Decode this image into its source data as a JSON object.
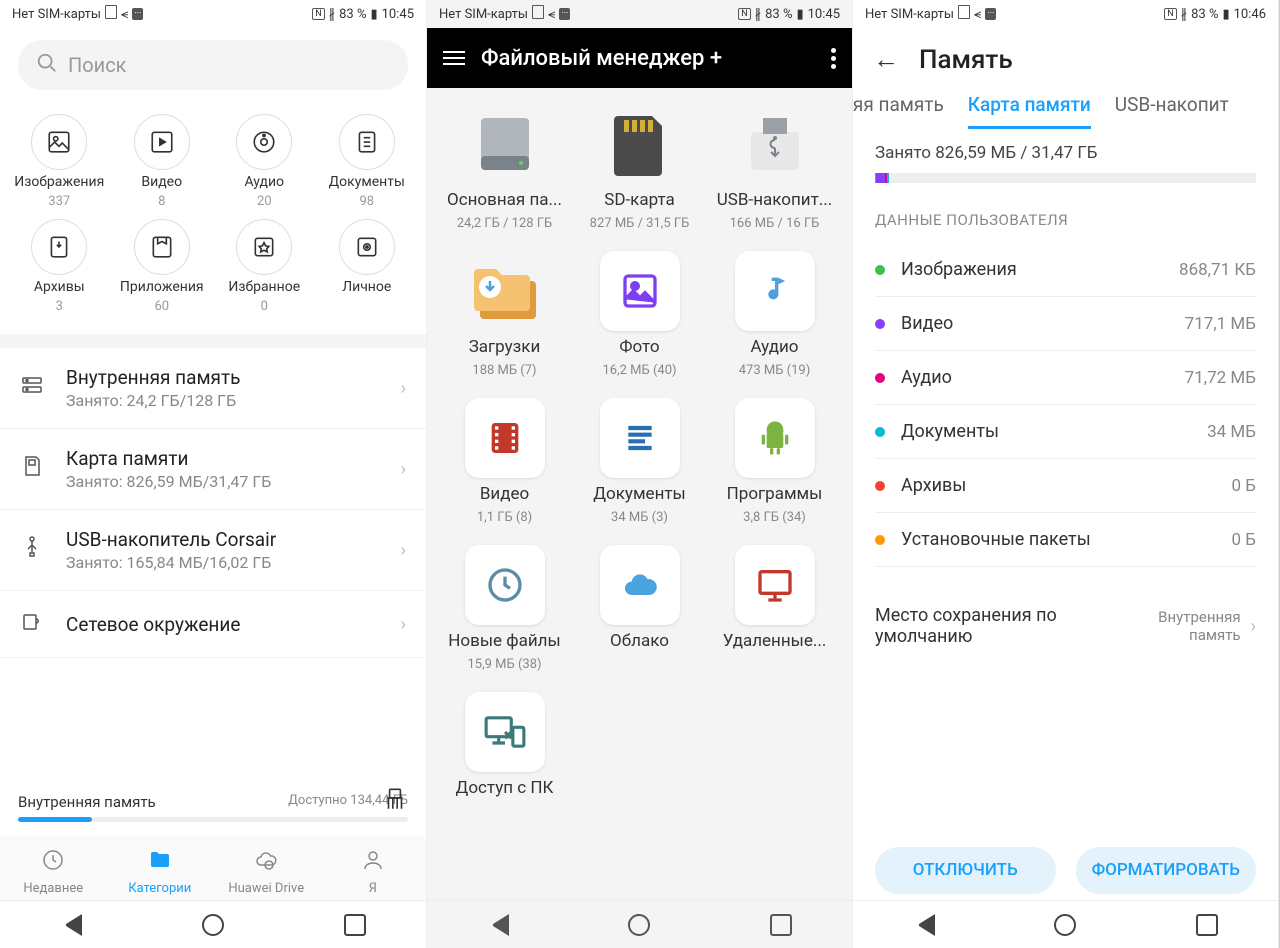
{
  "s1": {
    "status": {
      "left": "Нет SIM-карты",
      "right": "83 %",
      "time": "10:45"
    },
    "search_placeholder": "Поиск",
    "cats": [
      {
        "label": "Изображения",
        "count": "337"
      },
      {
        "label": "Видео",
        "count": "8"
      },
      {
        "label": "Аудио",
        "count": "20"
      },
      {
        "label": "Документы",
        "count": "98"
      },
      {
        "label": "Архивы",
        "count": "3"
      },
      {
        "label": "Приложения",
        "count": "60"
      },
      {
        "label": "Избранное",
        "count": "0"
      },
      {
        "label": "Личное",
        "count": ""
      }
    ],
    "storage": [
      {
        "title": "Внутренняя память",
        "sub": "Занято: 24,2 ГБ/128 ГБ"
      },
      {
        "title": "Карта памяти",
        "sub": "Занято: 826,59 МБ/31,47 ГБ"
      },
      {
        "title": "USB-накопитель Corsair",
        "sub": "Занято: 165,84 МБ/16,02 ГБ"
      },
      {
        "title": "Сетевое окружение",
        "sub": ""
      }
    ],
    "bottom": {
      "label": "Внутренняя память",
      "avail": "Доступно 134,44 ГБ"
    },
    "nav": [
      "Недавнее",
      "Категории",
      "Huawei Drive",
      "Я"
    ]
  },
  "s2": {
    "status": {
      "left": "Нет SIM-карты",
      "right": "83 %",
      "time": "10:45"
    },
    "title": "Файловый менеджер +",
    "items": [
      {
        "label": "Основная па...",
        "sub": "24,2 ГБ / 128 ГБ",
        "icon": "hdd",
        "frame": false
      },
      {
        "label": "SD-карта",
        "sub": "827 МБ / 31,5 ГБ",
        "icon": "sd",
        "frame": false
      },
      {
        "label": "USB-накопит...",
        "sub": "166 МБ / 16 ГБ",
        "icon": "usb",
        "frame": false
      },
      {
        "label": "Загрузки",
        "sub": "188 МБ (7)",
        "icon": "download",
        "frame": false
      },
      {
        "label": "Фото",
        "sub": "16,2 МБ (40)",
        "icon": "photo",
        "frame": true
      },
      {
        "label": "Аудио",
        "sub": "473 МБ (19)",
        "icon": "audio",
        "frame": true
      },
      {
        "label": "Видео",
        "sub": "1,1 ГБ (8)",
        "icon": "video",
        "frame": true
      },
      {
        "label": "Документы",
        "sub": "34 МБ (3)",
        "icon": "doc",
        "frame": true
      },
      {
        "label": "Программы",
        "sub": "3,8 ГБ (34)",
        "icon": "app",
        "frame": true
      },
      {
        "label": "Новые файлы",
        "sub": "15,9 МБ (38)",
        "icon": "clock",
        "frame": true
      },
      {
        "label": "Облако",
        "sub": "",
        "icon": "cloud",
        "frame": true
      },
      {
        "label": "Удаленные...",
        "sub": "",
        "icon": "remote",
        "frame": true
      },
      {
        "label": "Доступ с ПК",
        "sub": "",
        "icon": "pc",
        "frame": true
      }
    ]
  },
  "s3": {
    "status": {
      "left": "Нет SIM-карты",
      "right": "83 %",
      "time": "10:46"
    },
    "title": "Память",
    "tabs": [
      "нняя память",
      "Карта памяти",
      "USB-накопит"
    ],
    "summary": "Занято 826,59 МБ / 31,47 ГБ",
    "section": "ДАННЫЕ ПОЛЬЗОВАТЕЛЯ",
    "rows": [
      {
        "color": "#3cc24a",
        "name": "Изображения",
        "val": "868,71 КБ"
      },
      {
        "color": "#8a3cff",
        "name": "Видео",
        "val": "717,1 МБ"
      },
      {
        "color": "#e6007e",
        "name": "Аудио",
        "val": "71,72 МБ"
      },
      {
        "color": "#00bcd4",
        "name": "Документы",
        "val": "34 МБ"
      },
      {
        "color": "#f44336",
        "name": "Архивы",
        "val": "0 Б"
      },
      {
        "color": "#ff9800",
        "name": "Установочные пакеты",
        "val": "0 Б"
      }
    ],
    "default_row": {
      "left": "Место сохранения по умолчанию",
      "right": "Внутренняя память"
    },
    "btn1": "ОТКЛЮЧИТЬ",
    "btn2": "ФОРМАТИРОВАТЬ"
  }
}
